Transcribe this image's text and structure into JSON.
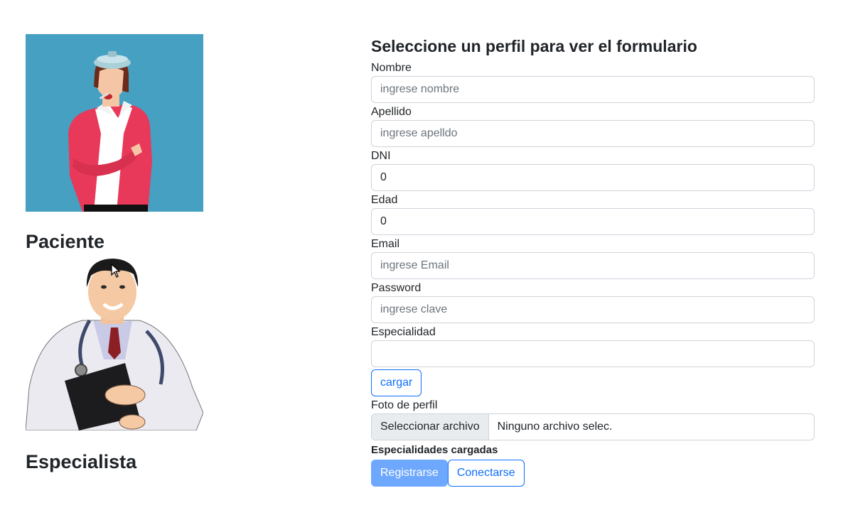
{
  "profiles": {
    "paciente": {
      "label": "Paciente"
    },
    "especialista": {
      "label": "Especialista"
    }
  },
  "form": {
    "title": "Seleccione un perfil para ver el formulario",
    "nombre": {
      "label": "Nombre",
      "placeholder": "ingrese nombre",
      "value": ""
    },
    "apellido": {
      "label": "Apellido",
      "placeholder": "ingrese apelldo",
      "value": ""
    },
    "dni": {
      "label": "DNI",
      "value": "0"
    },
    "edad": {
      "label": "Edad",
      "value": "0"
    },
    "email": {
      "label": "Email",
      "placeholder": "ingrese Email",
      "value": ""
    },
    "password": {
      "label": "Password",
      "placeholder": "ingrese clave",
      "value": ""
    },
    "especialidad": {
      "label": "Especialidad",
      "value": ""
    },
    "cargar_label": "cargar",
    "foto": {
      "label": "Foto de perfil",
      "button_label": "Seleccionar archivo",
      "status": "Ninguno archivo selec."
    },
    "especialidades_heading": "Especialidades cargadas",
    "registrarse_label": "Registrarse",
    "conectarse_label": "Conectarse"
  },
  "colors": {
    "primary": "#0d6efd",
    "primary_disabled": "#6ea8fe",
    "patient_bg": "#45a0c2",
    "jacket": "#e8395a"
  }
}
